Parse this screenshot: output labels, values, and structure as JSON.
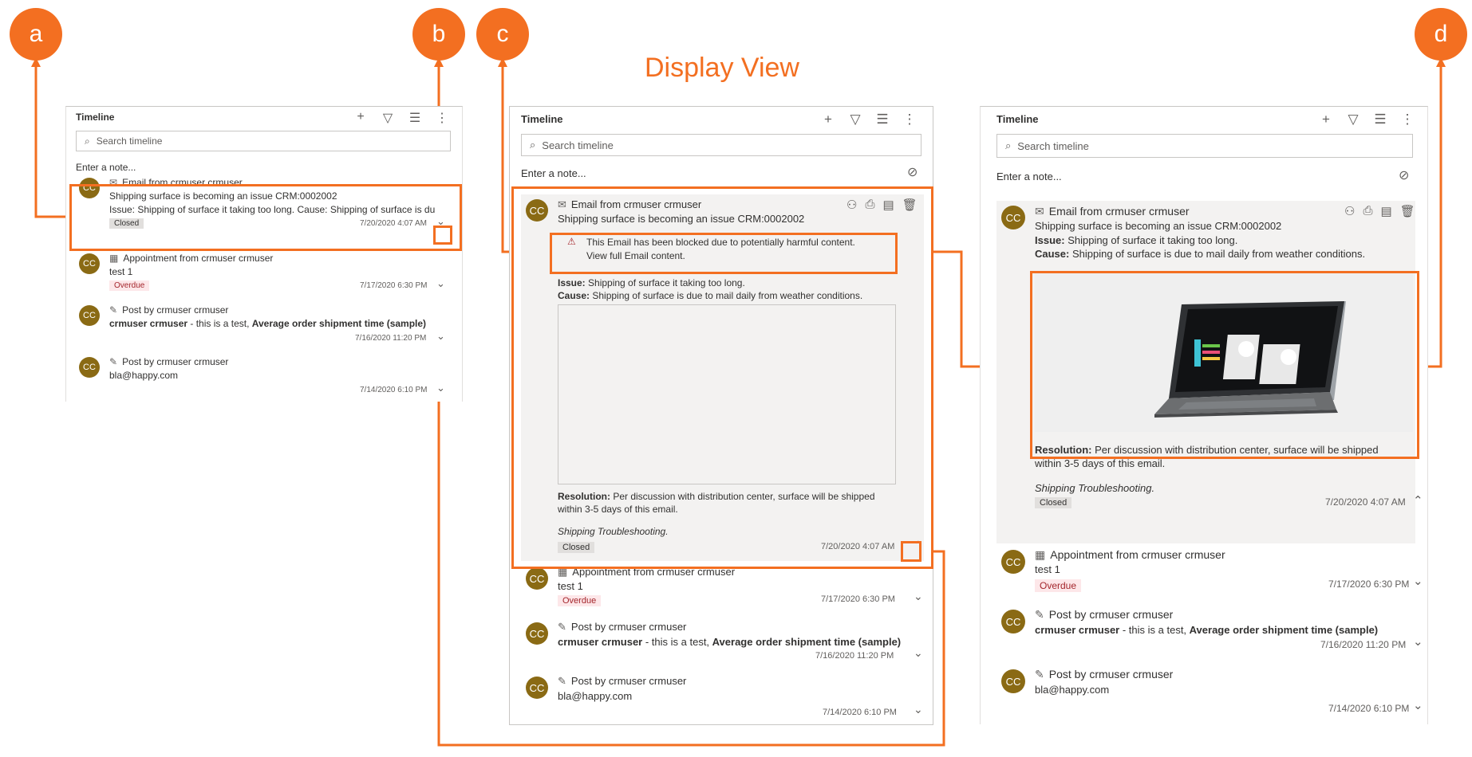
{
  "callouts": [
    "a",
    "b",
    "c",
    "d"
  ],
  "display_title": "Display View",
  "colors": {
    "accent": "#f36f21",
    "avatar": "#8a6a14",
    "closed_badge": "#e1dfdd",
    "overdue_badge": "#fde7e9"
  },
  "timeline": {
    "title": "Timeline",
    "search_placeholder": "Search timeline",
    "note_placeholder": "Enter a note...",
    "header_icons": [
      "plus-icon",
      "filter-icon",
      "sort-icon",
      "more-icon"
    ]
  },
  "avatar_initials": "CC",
  "email": {
    "title": "Email from crmuser crmuser",
    "subject": "Shipping surface is becoming an issue CRM:0002002",
    "summary": "Issue: Shipping of surface it taking too long. Cause: Shipping of surface is du",
    "issue_label": "Issue:",
    "issue_text": " Shipping of surface it taking too long.",
    "cause_label": "Cause:",
    "cause_text": " Shipping of surface is due to mail daily from weather conditions.",
    "blocked_line1": "This Email has been blocked due to potentially harmful content.",
    "blocked_line2": "View full Email content.",
    "resolution_label": "Resolution:",
    "resolution_text": " Per discussion with distribution center, surface will be shipped",
    "resolution_text2": "within 3-5 days of this email.",
    "footer": "Shipping Troubleshooting.",
    "status": "Closed",
    "date": "7/20/2020 4:07 AM"
  },
  "appointment": {
    "title": "Appointment from crmuser crmuser",
    "body": "test 1",
    "status": "Overdue",
    "date": "7/17/2020 6:30 PM"
  },
  "post1": {
    "title": "Post by crmuser crmuser",
    "author": "crmuser crmuser",
    "body": " - this is a test, ",
    "link": "Average order shipment time (sample)",
    "date": "7/16/2020 11:20 PM"
  },
  "post2": {
    "title": "Post by crmuser crmuser",
    "body": "bla@happy.com",
    "date": "7/14/2020 6:10 PM"
  }
}
